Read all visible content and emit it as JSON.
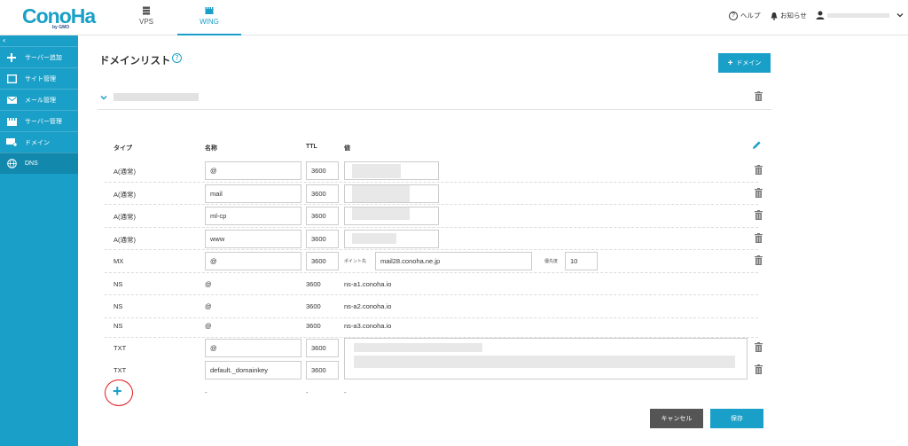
{
  "header": {
    "logo_text": "ConoHa",
    "logo_sub": "by GMO",
    "tabs": [
      {
        "label": "VPS",
        "icon": "server-icon"
      },
      {
        "label": "WING",
        "icon": "wing-icon"
      }
    ],
    "help_label": "ヘルプ",
    "notice_label": "お知らせ"
  },
  "sidebar": {
    "items": [
      {
        "label": "サーバー追加",
        "icon": "plus-icon"
      },
      {
        "label": "サイト管理",
        "icon": "site-icon"
      },
      {
        "label": "メール管理",
        "icon": "mail-icon"
      },
      {
        "label": "サーバー管理",
        "icon": "server-manage-icon"
      },
      {
        "label": "ドメイン",
        "icon": "domain-icon"
      },
      {
        "label": "DNS",
        "icon": "globe-icon",
        "active": true
      }
    ]
  },
  "main": {
    "title": "ドメインリスト",
    "add_domain_label": "ドメイン",
    "columns": {
      "type": "タイプ",
      "name": "名称",
      "ttl": "TTL",
      "value": "値"
    },
    "records": [
      {
        "type": "A(通常)",
        "name": "@",
        "ttl": "3600"
      },
      {
        "type": "A(通常)",
        "name": "mail",
        "ttl": "3600"
      },
      {
        "type": "A(通常)",
        "name": "ml-cp",
        "ttl": "3600"
      },
      {
        "type": "A(通常)",
        "name": "www",
        "ttl": "3600"
      },
      {
        "type": "MX",
        "name": "@",
        "ttl": "3600",
        "point_label": "ポイント先",
        "value": "mail28.conoha.ne.jp",
        "priority_label": "優先度",
        "priority": "10"
      },
      {
        "type": "NS",
        "name": "@",
        "ttl": "3600",
        "value": "ns-a1.conoha.io"
      },
      {
        "type": "NS",
        "name": "@",
        "ttl": "3600",
        "value": "ns-a2.conoha.io"
      },
      {
        "type": "NS",
        "name": "@",
        "ttl": "3600",
        "value": "ns-a3.conoha.io"
      },
      {
        "type": "TXT",
        "name": "@",
        "ttl": "3600"
      },
      {
        "type": "TXT",
        "name": "default._domainkey",
        "ttl": "3600"
      }
    ],
    "new_row": {
      "name": "-",
      "ttl": "-",
      "value": "-"
    },
    "cancel_label": "キャンセル",
    "save_label": "保存"
  },
  "colors": {
    "accent": "#1aa0c8",
    "sidebar_active": "#1288ad",
    "cancel": "#555555",
    "highlight_circle": "#e3191e"
  }
}
